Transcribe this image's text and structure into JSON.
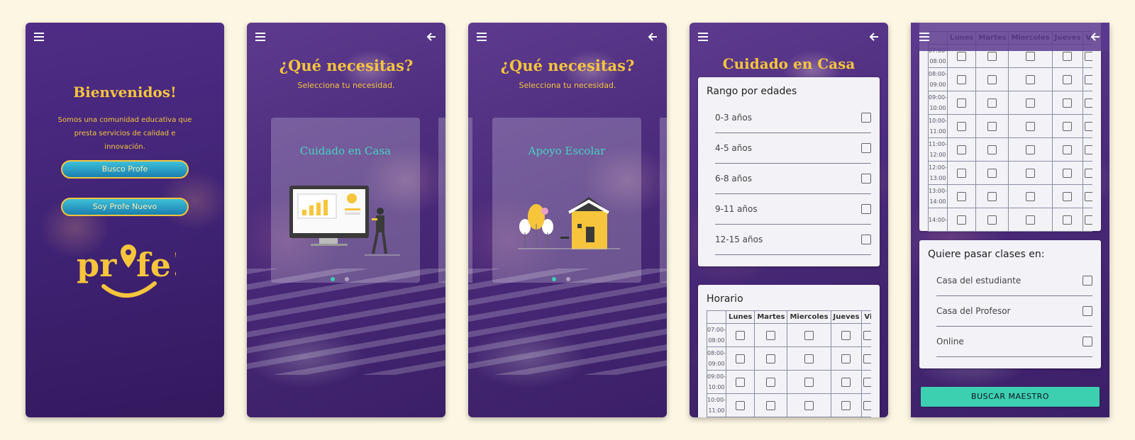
{
  "screen1": {
    "title": "Bienvenidos!",
    "subtitle": "Somos una comunidad educativa que presta servicios de calidad e innovación.",
    "btn_busco": "Busco Profe",
    "btn_soy": "Soy Profe Nuevo",
    "logo_text": "profe!"
  },
  "screen2": {
    "title": "¿Qué necesitas?",
    "subtitle": "Selecciona tu necesidad.",
    "card_title": "Cuidado en Casa"
  },
  "screen3": {
    "title": "¿Qué necesitas?",
    "subtitle": "Selecciona tu necesidad.",
    "card_title": "Apoyo Escolar"
  },
  "screen4": {
    "title": "Cuidado en Casa",
    "age_panel_title": "Rango por edades",
    "ages": [
      "0-3 años",
      "4-5 años",
      "6-8 años",
      "9-11 años",
      "12-15 años"
    ],
    "schedule_title": "Horario"
  },
  "schedule": {
    "days": [
      "Lunes",
      "Martes",
      "Miercoles",
      "Jueves",
      "Vi"
    ],
    "times": [
      "07:00-08:00",
      "08:00-09:00",
      "09:00-10:00",
      "10:00-11:00",
      "11:00-12:00",
      "12:00-13:00",
      "13:00-14:00",
      "14:00-"
    ]
  },
  "screen5": {
    "place_panel_title": "Quiere pasar clases en:",
    "places": [
      "Casa del estudiante",
      "Casa del Profesor",
      "Online"
    ],
    "search_button": "BUSCAR MAESTRO"
  },
  "colors": {
    "accent_yellow": "#f6c53c",
    "accent_teal": "#3ccfb0",
    "bg_purple": "#4a2a7a",
    "page_bg": "#fdf6e3"
  }
}
